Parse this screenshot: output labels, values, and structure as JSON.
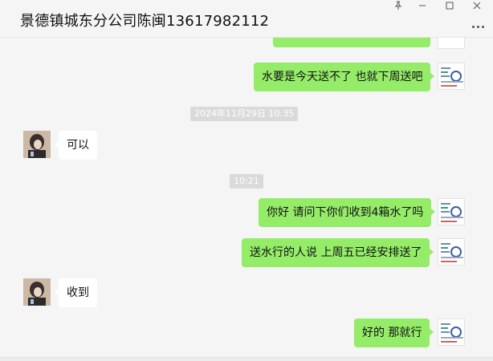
{
  "window": {
    "title": "景德镇城东分公司陈闽13617982112",
    "buttons": {
      "pin": "📌",
      "minimize": "—",
      "maximize": "☐",
      "close": "✕"
    }
  },
  "messages": [
    {
      "from": "me",
      "text": "水要是今天送不了 也就下周送吧"
    },
    {
      "time": "2024年11月29日 10:35"
    },
    {
      "from": "other",
      "text": "可以"
    },
    {
      "time": "10:21"
    },
    {
      "from": "me",
      "text": "你好 请问下你们收到4箱水了吗"
    },
    {
      "from": "me",
      "text": "送水行的人说 上周五已经安排送了"
    },
    {
      "from": "other",
      "text": "收到"
    },
    {
      "from": "me",
      "text": "好的 那就行"
    }
  ],
  "colors": {
    "my_bubble": "#95ec69",
    "other_bubble": "#ffffff",
    "background": "#f5f5f5",
    "time_badge": "#dadada"
  }
}
